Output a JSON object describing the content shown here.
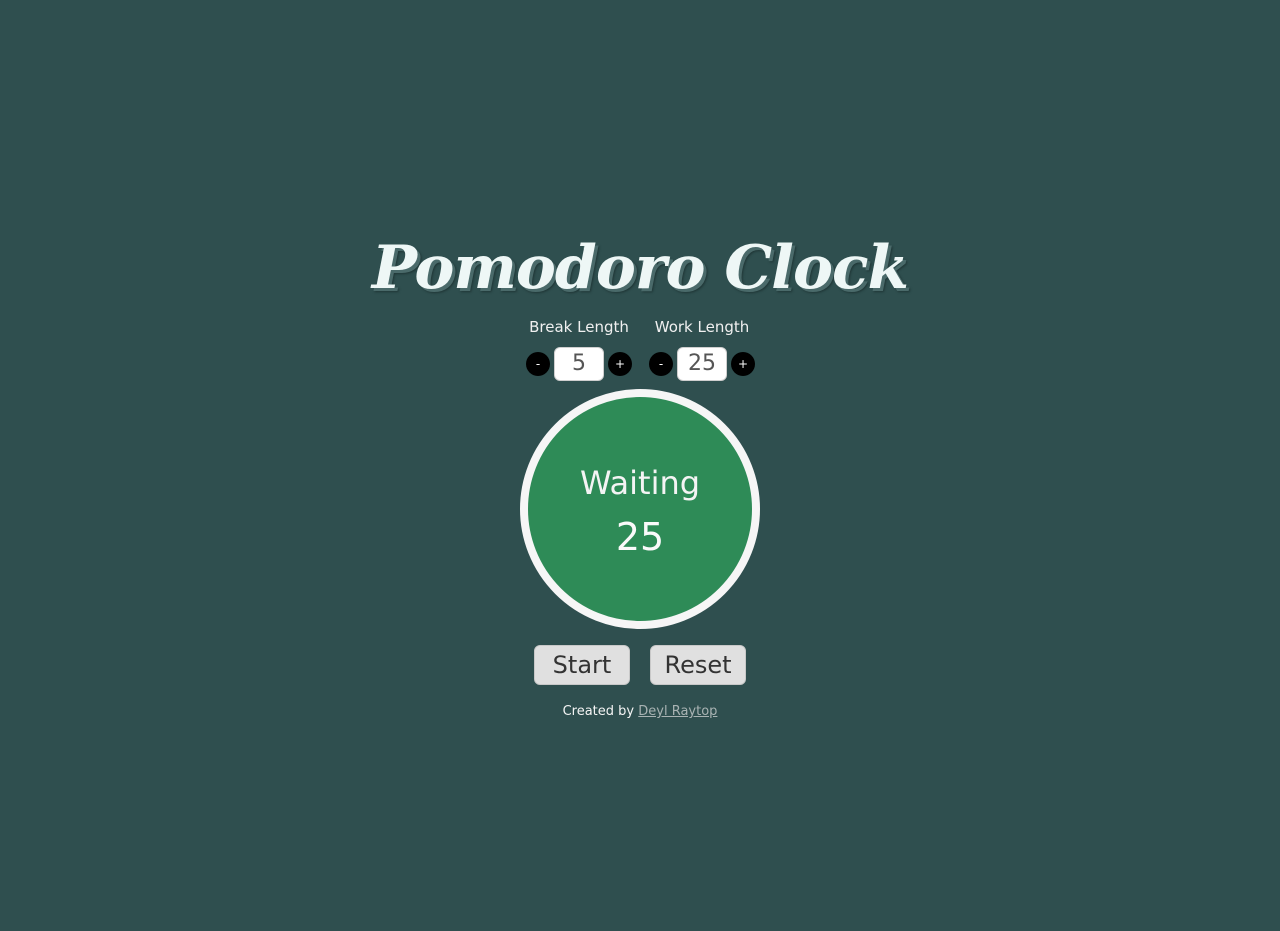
{
  "app": {
    "title": "Pomodoro Clock"
  },
  "break_length": {
    "label": "Break Length",
    "decrement_label": "-",
    "increment_label": "+",
    "value": "5"
  },
  "work_length": {
    "label": "Work Length",
    "decrement_label": "-",
    "increment_label": "+",
    "value": "25"
  },
  "timer": {
    "status": "Waiting",
    "count": "25"
  },
  "actions": {
    "start_label": "Start",
    "reset_label": "Reset"
  },
  "footer": {
    "prefix": "Created by ",
    "author_link": "Deyl Raytop"
  },
  "colors": {
    "background": "#2f4f4f",
    "timer_fill": "#2e8b57",
    "timer_ring": "#f6f6f6",
    "stepper_button": "#000000",
    "action_button": "#e0e0e0"
  }
}
